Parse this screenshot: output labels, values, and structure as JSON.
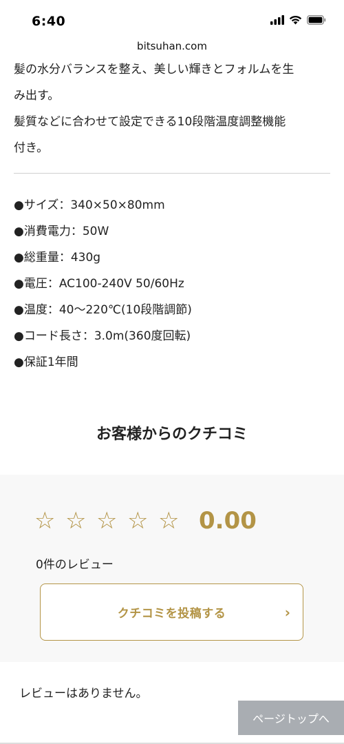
{
  "status": {
    "time": "6:40",
    "url": "bitsuhan.com"
  },
  "description": {
    "lines": [
      "髪の水分バランスを整え、美しい輝きとフォルムを生",
      "み出す。",
      "髪質などに合わせて設定できる10段階温度調整機能",
      "付き。"
    ]
  },
  "specs": [
    "●サイズ：340×50×80mm",
    "●消費電力：50W",
    "●総重量：430g",
    "●電圧：AC100-240V 50/60Hz",
    "●温度：40〜220℃(10段階調節)",
    "●コード長さ：3.0m(360度回転)",
    "●保証1年間"
  ],
  "reviews": {
    "title": "お客様からのクチコミ",
    "stars": [
      "☆",
      "☆",
      "☆",
      "☆",
      "☆"
    ],
    "rating": "0.00",
    "count": "0件のレビュー",
    "post_label": "クチコミを投稿する",
    "post_chevron": "›",
    "empty_message": "レビューはありません。"
  },
  "page_top_label": "ページトップへ",
  "colors": {
    "accent": "#b39446",
    "panel": "#f8f8f8",
    "page_top_bg": "#a9adb2"
  }
}
